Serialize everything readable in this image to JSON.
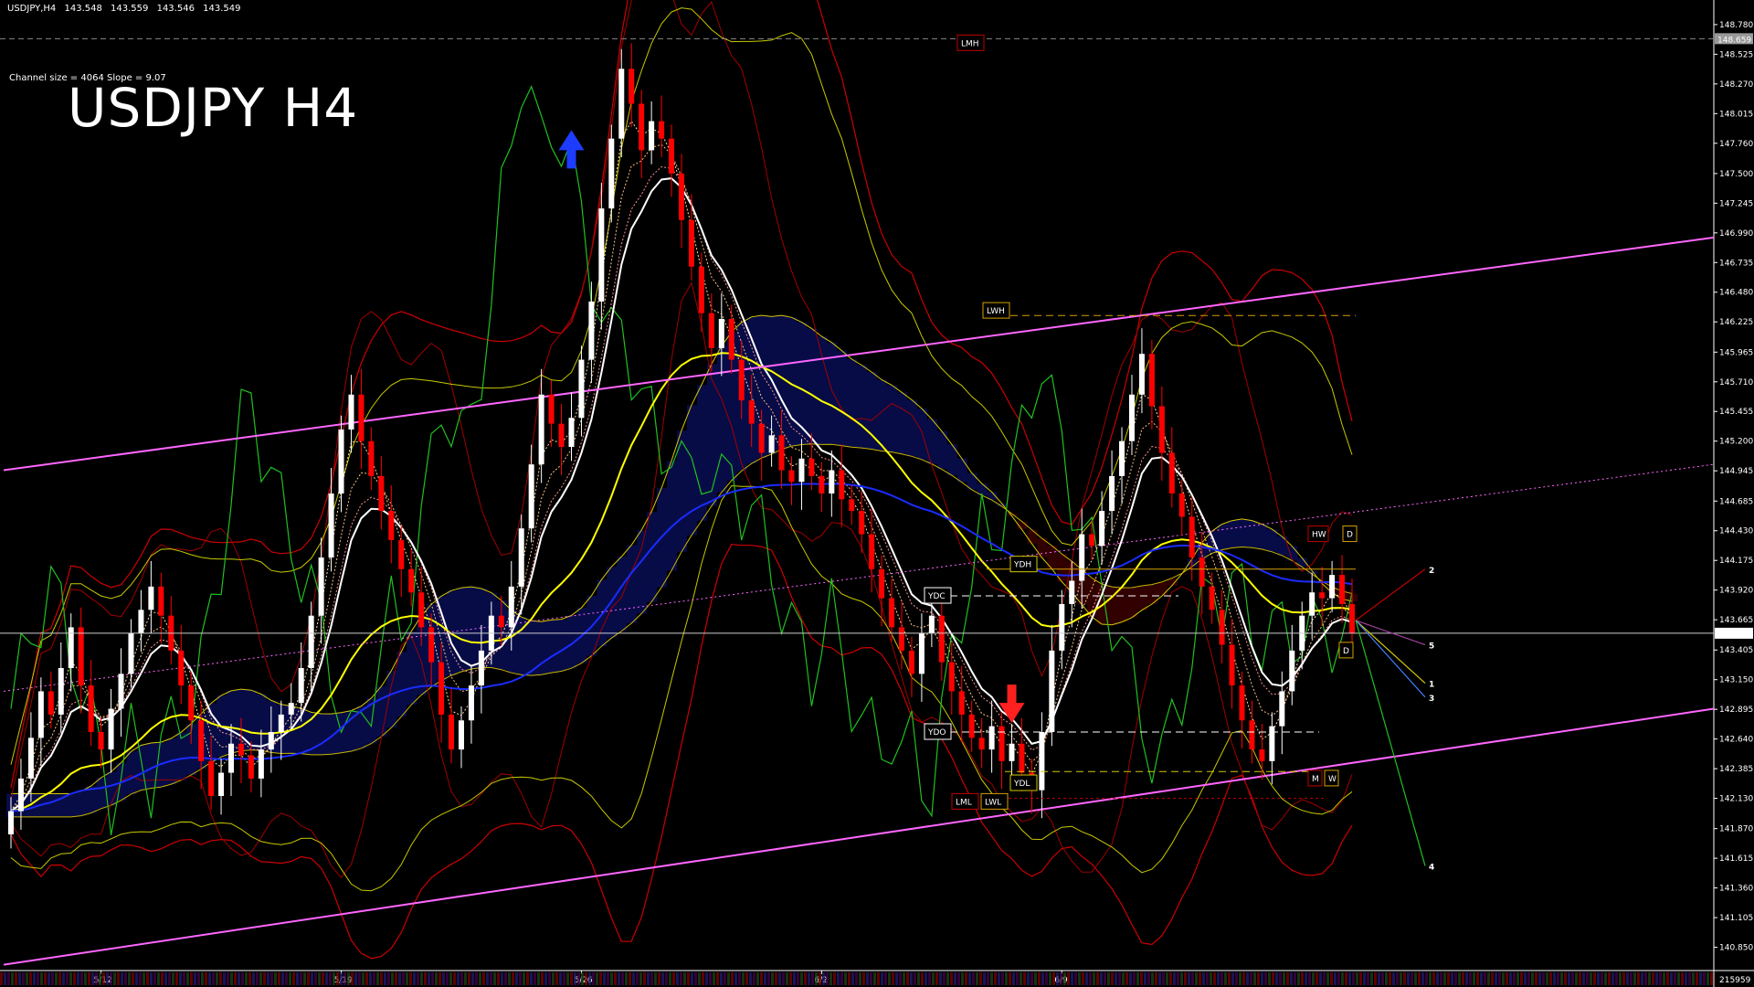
{
  "header": {
    "symbol": "USDJPY,H4",
    "open": "143.548",
    "high": "143.559",
    "low": "143.546",
    "close": "143.549"
  },
  "channel_info": "Channel size = 4064  Slope = 9.07",
  "title": "USDJPY H4",
  "current_price": "143.549",
  "lmh_price": "148.659",
  "volume_label": "215959",
  "colors": {
    "bull": "#ffffff",
    "bear": "#ff0000",
    "channel": "#ff66ff",
    "ema_white": "#ffffff",
    "ema_yellow": "#ffff00",
    "ema_blue": "#1a2cff",
    "green_osc": "#20c020",
    "bollinger": "#cc0000",
    "cloud_red": "#b00000",
    "cloud_blue": "#1a2cff"
  },
  "chart_data": {
    "type": "candlestick",
    "ylim": [
      140.65,
      148.85
    ],
    "price_ticks": [
      "148.780",
      "148.525",
      "148.270",
      "148.015",
      "147.760",
      "147.500",
      "147.245",
      "146.990",
      "146.735",
      "146.480",
      "146.225",
      "145.965",
      "145.710",
      "145.455",
      "145.200",
      "144.945",
      "144.685",
      "144.430",
      "144.175",
      "143.920",
      "143.665",
      "143.405",
      "143.150",
      "142.895",
      "142.640",
      "142.385",
      "142.130",
      "141.870",
      "141.615",
      "141.360",
      "141.105",
      "140.850"
    ],
    "date_ticks": [
      "5/12",
      "5/19",
      "5/26",
      "6/2",
      "6/9"
    ],
    "level_labels": [
      "LMH",
      "LWH",
      "YDH",
      "YDC",
      "YDO",
      "YDL",
      "LML",
      "LWL",
      "HW",
      "D",
      "D",
      "M",
      "W"
    ],
    "projection_labels": [
      "2",
      "5",
      "1",
      "3",
      "4"
    ],
    "closes": [
      142.02,
      142.3,
      142.65,
      143.05,
      142.85,
      143.25,
      143.6,
      143.1,
      142.7,
      142.55,
      142.9,
      143.2,
      143.55,
      143.75,
      143.95,
      143.7,
      143.4,
      143.1,
      142.8,
      142.45,
      142.15,
      142.35,
      142.6,
      142.5,
      142.3,
      142.55,
      142.7,
      142.85,
      142.95,
      143.25,
      143.7,
      144.2,
      144.75,
      145.3,
      145.6,
      145.2,
      144.9,
      144.6,
      144.35,
      144.1,
      143.9,
      143.6,
      143.3,
      142.85,
      142.55,
      142.8,
      143.1,
      143.4,
      143.7,
      143.6,
      143.95,
      144.45,
      145.0,
      145.6,
      145.35,
      145.15,
      145.4,
      145.9,
      146.4,
      147.2,
      147.8,
      148.4,
      148.1,
      147.7,
      147.95,
      147.8,
      147.5,
      147.1,
      146.7,
      146.3,
      146.0,
      146.25,
      145.9,
      145.55,
      145.35,
      145.1,
      145.25,
      144.95,
      144.85,
      145.05,
      144.9,
      144.75,
      144.95,
      144.7,
      144.6,
      144.4,
      144.1,
      143.85,
      143.6,
      143.4,
      143.2,
      143.55,
      143.7,
      143.3,
      143.05,
      142.85,
      142.65,
      142.55,
      142.75,
      142.45,
      142.6,
      142.35,
      142.2,
      142.7,
      143.4,
      143.8,
      144.0,
      144.4,
      144.3,
      144.6,
      144.9,
      145.2,
      145.6,
      145.95,
      145.5,
      145.1,
      144.75,
      144.55,
      144.2,
      143.95,
      143.75,
      143.45,
      143.1,
      142.8,
      142.55,
      142.45,
      142.75,
      143.05,
      143.4,
      143.7,
      143.9,
      143.85,
      144.05,
      143.8,
      143.55
    ],
    "channel": {
      "upper": [
        144.95,
        146.95
      ],
      "lower": [
        140.7,
        142.9
      ],
      "mid": [
        143.05,
        145.0
      ]
    }
  }
}
